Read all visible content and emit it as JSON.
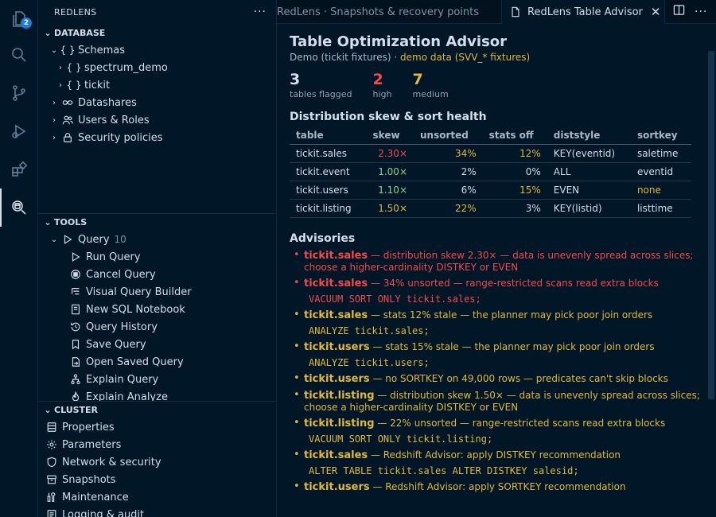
{
  "activity": {
    "explorer_badge": "2"
  },
  "sidebar": {
    "title": "REDLENS",
    "database": {
      "label": "DATABASE",
      "items": [
        "Schemas",
        "spectrum_demo",
        "tickit",
        "Datashares",
        "Users & Roles",
        "Security policies"
      ]
    },
    "tools": {
      "label": "TOOLS",
      "query_label": "Query",
      "query_count": "10",
      "items": [
        "Run Query",
        "Cancel Query",
        "Visual Query Builder",
        "New SQL Notebook",
        "Query History",
        "Save Query",
        "Open Saved Query",
        "Explain Query",
        "Explain Analyze"
      ]
    },
    "cluster": {
      "label": "CLUSTER",
      "items": [
        "Properties",
        "Parameters",
        "Network & security",
        "Snapshots",
        "Maintenance",
        "Logging & audit"
      ]
    }
  },
  "tabs": {
    "inactive": "RedLens · Snapshots & recovery points",
    "active": "RedLens Table Advisor"
  },
  "advisor": {
    "title": "Table Optimization Advisor",
    "subtitle_prefix": "Demo (tickit fixtures) · ",
    "subtitle_highlight": "demo data (SVV_* fixtures)",
    "stats": [
      {
        "value": "3",
        "label": "tables flagged"
      },
      {
        "value": "2",
        "label": "high"
      },
      {
        "value": "7",
        "label": "medium"
      }
    ],
    "skew_heading": "Distribution skew & sort health",
    "columns": [
      "table",
      "skew",
      "unsorted",
      "stats off",
      "diststyle",
      "sortkey"
    ],
    "rows": [
      {
        "table": "tickit.sales",
        "skew": "2.30×",
        "unsorted": "34%",
        "stats_off": "12%",
        "diststyle": "KEY(eventid)",
        "sortkey": "saletime"
      },
      {
        "table": "tickit.event",
        "skew": "1.00×",
        "unsorted": "2%",
        "stats_off": "0%",
        "diststyle": "ALL",
        "sortkey": "eventid"
      },
      {
        "table": "tickit.users",
        "skew": "1.10×",
        "unsorted": "6%",
        "stats_off": "15%",
        "diststyle": "EVEN",
        "sortkey": "none"
      },
      {
        "table": "tickit.listing",
        "skew": "1.50×",
        "unsorted": "22%",
        "stats_off": "3%",
        "diststyle": "KEY(listid)",
        "sortkey": "listtime"
      }
    ],
    "advisories_heading": "Advisories",
    "advisories": [
      {
        "table": "tickit.sales",
        "text": " — distribution skew 2.30× — data is unevenly spread across slices; choose a higher-cardinality DISTKEY or EVEN",
        "code": ""
      },
      {
        "table": "tickit.sales",
        "text": " — 34% unsorted — range-restricted scans read extra blocks",
        "code": "VACUUM SORT ONLY tickit.sales;"
      },
      {
        "table": "tickit.sales",
        "text": " — stats 12% stale — the planner may pick poor join orders",
        "code": "ANALYZE tickit.sales;"
      },
      {
        "table": "tickit.users",
        "text": " — stats 15% stale — the planner may pick poor join orders",
        "code": "ANALYZE tickit.users;"
      },
      {
        "table": "tickit.users",
        "text": " — no SORTKEY on 49,000 rows — predicates can't skip blocks",
        "code": ""
      },
      {
        "table": "tickit.listing",
        "text": " — distribution skew 1.50× — data is unevenly spread across slices; choose a higher-cardinality DISTKEY or EVEN",
        "code": ""
      },
      {
        "table": "tickit.listing",
        "text": " — 22% unsorted — range-restricted scans read extra blocks",
        "code": "VACUUM SORT ONLY tickit.listing;"
      },
      {
        "table": "tickit.sales",
        "text": " — Redshift Advisor: apply DISTKEY recommendation",
        "code": "ALTER TABLE tickit.sales ALTER DISTKEY salesid;"
      },
      {
        "table": "tickit.users",
        "text": " — Redshift Advisor: apply SORTKEY recommendation",
        "code": ""
      }
    ]
  },
  "colors": {
    "background": "#011627",
    "high": "#f14c4c",
    "medium": "#e2b93d",
    "ok": "#7fd88f"
  }
}
